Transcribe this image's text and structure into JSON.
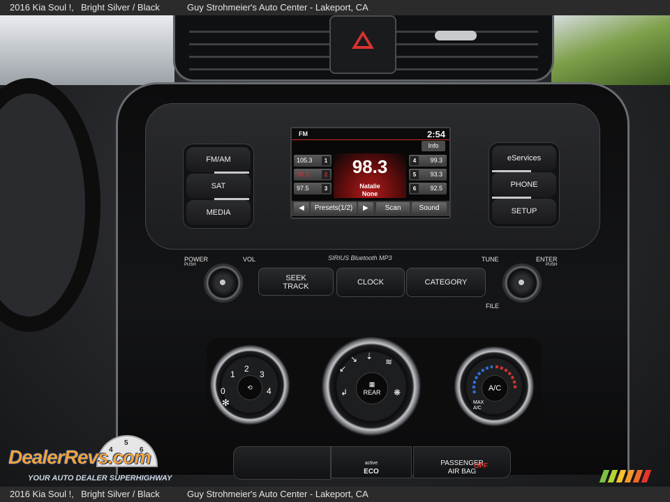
{
  "caption": {
    "model": "2016 Kia Soul !,",
    "color": "Bright Silver / Black",
    "dealer": "Guy Strohmeier's Auto Center - Lakeport, CA"
  },
  "radio": {
    "band": "FM",
    "time": "2:54",
    "info_button": "Info",
    "frequency": "98.3",
    "artist": "Natalie",
    "title": "None",
    "presets_left": [
      {
        "freq": "105.3",
        "num": "1"
      },
      {
        "freq": "98.3",
        "num": "2"
      },
      {
        "freq": "97.5",
        "num": "3"
      }
    ],
    "presets_right": [
      {
        "freq": "99.3",
        "num": "4"
      },
      {
        "freq": "93.3",
        "num": "5"
      },
      {
        "freq": "92.5",
        "num": "6"
      }
    ],
    "softkeys": {
      "prev": "◀",
      "presets": "Presets(1/2)",
      "next": "▶",
      "scan": "Scan",
      "sound": "Sound"
    }
  },
  "left_buttons": [
    "FM/AM",
    "SAT",
    "MEDIA"
  ],
  "right_buttons": [
    "eServices",
    "PHONE",
    "SETUP"
  ],
  "labels": {
    "power": "POWER",
    "power_sub": "PUSH",
    "vol": "VOL",
    "tune": "TUNE",
    "enter": "ENTER",
    "enter_sub": "PUSH",
    "file": "FILE",
    "logos": "SIRIUS Bluetooth MP3"
  },
  "center_buttons": {
    "seek_line1": "SEEK",
    "seek_line2": "TRACK",
    "clock": "CLOCK",
    "category": "CATEGORY"
  },
  "hvac": {
    "fan_numbers": [
      "0",
      "1",
      "2",
      "3",
      "4"
    ],
    "mode_center": "REAR",
    "ac_label": "A/C",
    "max_ac": "MAX A/C"
  },
  "bottom_buttons": {
    "eco_line1": "active",
    "eco_line2": "ECO",
    "airbag_line1": "PASSENGER",
    "airbag_line2": "AIR BAG",
    "airbag_status": "OFF"
  },
  "watermark": {
    "brand": "DealerRevs.com",
    "tagline": "YOUR AUTO DEALER SUPERHIGHWAY",
    "gauge_digits": [
      "4",
      "5",
      "6"
    ]
  },
  "colors": {
    "hazard": "#d8322f",
    "screen_accent": "#c9302c",
    "brand_orange": "#f0a43a",
    "brand_blue": "#1c3b7a"
  }
}
